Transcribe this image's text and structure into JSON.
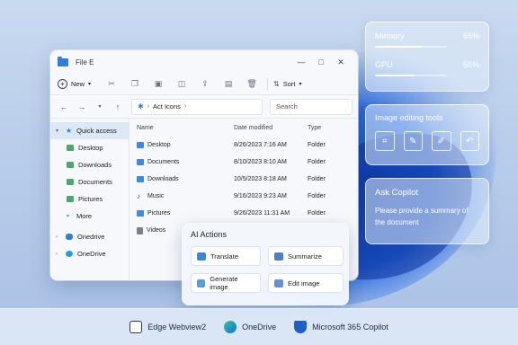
{
  "explorer": {
    "title": "File E",
    "window_controls": [
      "—",
      "□",
      "✕"
    ],
    "toolbar": {
      "new_label": "New",
      "sort_label": "Sort"
    },
    "address": {
      "path": "Act Icons",
      "search_placeholder": "Search"
    },
    "sidebar": {
      "items": [
        {
          "label": "Quick access",
          "active": true
        },
        {
          "label": "Desktop"
        },
        {
          "label": "Downloads"
        },
        {
          "label": "Documents"
        },
        {
          "label": "Pictures"
        },
        {
          "label": "More"
        },
        {
          "label": "Onedrive"
        },
        {
          "label": "OneDrive"
        }
      ]
    },
    "columns": [
      "Name",
      "Date modified",
      "Type"
    ],
    "rows": [
      {
        "name": "Desktop",
        "date": "8/26/2023 7:16 AM",
        "type": "Folder",
        "icon": "folder-icon"
      },
      {
        "name": "Documents",
        "date": "8/10/2023 8:10 AM",
        "type": "Folder",
        "icon": "folder-icon"
      },
      {
        "name": "Downloads",
        "date": "10/5/2023 8:18 AM",
        "type": "Folder",
        "icon": "folder-icon"
      },
      {
        "name": "Music",
        "date": "9/16/2023 9:23 AM",
        "type": "Folder",
        "icon": "music-icon"
      },
      {
        "name": "Pictures",
        "date": "9/26/2023 11:31 AM",
        "type": "Folder",
        "icon": "folder-icon"
      },
      {
        "name": "Videos",
        "date": "",
        "type": "",
        "icon": "video-icon"
      }
    ]
  },
  "ai_actions": {
    "title": "AI Actions",
    "buttons": [
      "Translate",
      "Summarize",
      "Generate image",
      "Edit image"
    ]
  },
  "performance": {
    "memory_label": "Memory",
    "memory_value": "65%",
    "memory_level": 0.65,
    "gpu_label": "GPU",
    "gpu_value": "55%",
    "gpu_level": 0.55
  },
  "image_tools": {
    "title": "Image editing tools",
    "tools": [
      "crop-icon",
      "pen-icon",
      "edit-icon",
      "undo-icon"
    ]
  },
  "copilot": {
    "title": "Ask Copilot",
    "prompt": "Please provide a summary of the document"
  },
  "taskbar": {
    "items": [
      "Edge Webview2",
      "OneDrive",
      "Microsoft 365 Copilot"
    ]
  },
  "colors": {
    "accent": "#2f7fd8",
    "wallpaper": "#b8cdea"
  }
}
